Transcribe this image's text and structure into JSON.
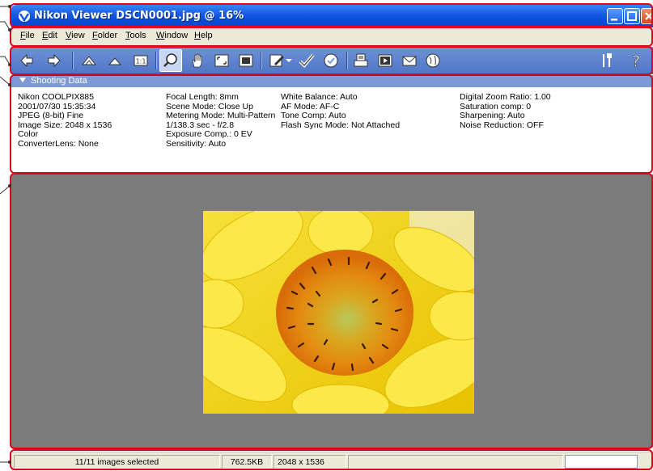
{
  "window": {
    "title": "Nikon Viewer DSCN0001.jpg @ 16%"
  },
  "menu": [
    "File",
    "Edit",
    "View",
    "Folder",
    "Tools",
    "Window",
    "Help"
  ],
  "toolbar": {
    "icons": [
      "back-arrow-icon",
      "forward-arrow-icon",
      "rotate-left-icon",
      "rotate-right-icon",
      "actual-size-icon",
      "zoom-icon",
      "hand-tool-icon",
      "fit-window-icon",
      "full-screen-icon",
      "edit-icon",
      "checkmark-icon",
      "protect-icon",
      "print-icon",
      "slideshow-icon",
      "email-icon",
      "web-icon",
      "settings-icon",
      "help-icon"
    ]
  },
  "shooting_data": {
    "header": "Shooting Data",
    "col1": [
      "Nikon COOLPIX885",
      "2001/07/30 15:35:34",
      "JPEG (8-bit) Fine",
      "Image Size:  2048 x 1536",
      "Color",
      "ConverterLens: None"
    ],
    "col2": [
      "Focal Length: 8mm",
      "Scene Mode: Close Up",
      "Metering Mode: Multi-Pattern",
      "1/138.3 sec - f/2.8",
      "Exposure Comp.: 0 EV",
      "Sensitivity: Auto"
    ],
    "col3": [
      "White Balance: Auto",
      "AF Mode: AF-C",
      "Tone Comp: Auto",
      "Flash Sync Mode: Not Attached"
    ],
    "col4": [
      "Digital Zoom Ratio: 1.00",
      "Saturation comp: 0",
      "Sharpening: Auto",
      "Noise Reduction: OFF"
    ]
  },
  "status": {
    "selected": "11/11 images selected",
    "filesize": "762.5KB",
    "dimensions": "2048 x 1536"
  },
  "colors": {
    "callout": "#e0001a",
    "titlebar": "#0a4bd6",
    "viewer_bg": "#7b7b7b"
  }
}
